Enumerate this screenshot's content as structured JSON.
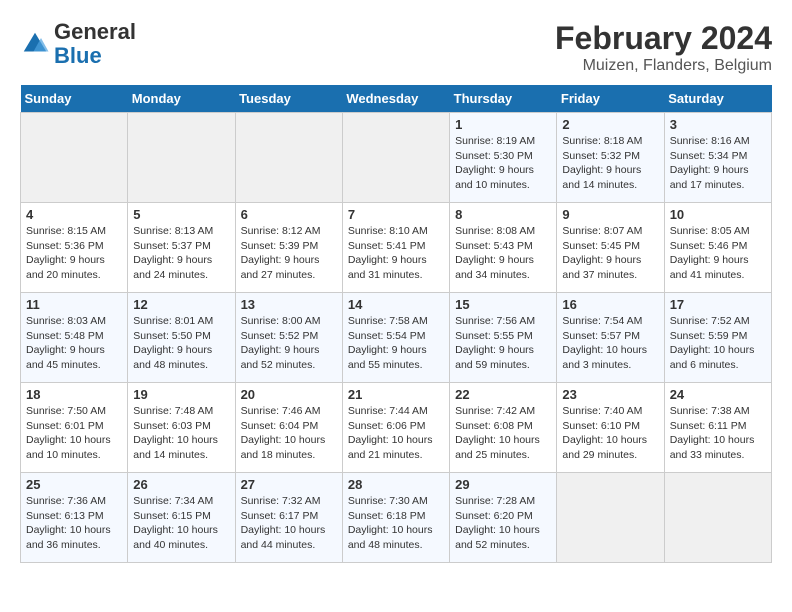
{
  "logo": {
    "text_general": "General",
    "text_blue": "Blue"
  },
  "title": "February 2024",
  "subtitle": "Muizen, Flanders, Belgium",
  "days_of_week": [
    "Sunday",
    "Monday",
    "Tuesday",
    "Wednesday",
    "Thursday",
    "Friday",
    "Saturday"
  ],
  "weeks": [
    [
      {
        "day": "",
        "info": ""
      },
      {
        "day": "",
        "info": ""
      },
      {
        "day": "",
        "info": ""
      },
      {
        "day": "",
        "info": ""
      },
      {
        "day": "1",
        "info": "Sunrise: 8:19 AM\nSunset: 5:30 PM\nDaylight: 9 hours and 10 minutes."
      },
      {
        "day": "2",
        "info": "Sunrise: 8:18 AM\nSunset: 5:32 PM\nDaylight: 9 hours and 14 minutes."
      },
      {
        "day": "3",
        "info": "Sunrise: 8:16 AM\nSunset: 5:34 PM\nDaylight: 9 hours and 17 minutes."
      }
    ],
    [
      {
        "day": "4",
        "info": "Sunrise: 8:15 AM\nSunset: 5:36 PM\nDaylight: 9 hours and 20 minutes."
      },
      {
        "day": "5",
        "info": "Sunrise: 8:13 AM\nSunset: 5:37 PM\nDaylight: 9 hours and 24 minutes."
      },
      {
        "day": "6",
        "info": "Sunrise: 8:12 AM\nSunset: 5:39 PM\nDaylight: 9 hours and 27 minutes."
      },
      {
        "day": "7",
        "info": "Sunrise: 8:10 AM\nSunset: 5:41 PM\nDaylight: 9 hours and 31 minutes."
      },
      {
        "day": "8",
        "info": "Sunrise: 8:08 AM\nSunset: 5:43 PM\nDaylight: 9 hours and 34 minutes."
      },
      {
        "day": "9",
        "info": "Sunrise: 8:07 AM\nSunset: 5:45 PM\nDaylight: 9 hours and 37 minutes."
      },
      {
        "day": "10",
        "info": "Sunrise: 8:05 AM\nSunset: 5:46 PM\nDaylight: 9 hours and 41 minutes."
      }
    ],
    [
      {
        "day": "11",
        "info": "Sunrise: 8:03 AM\nSunset: 5:48 PM\nDaylight: 9 hours and 45 minutes."
      },
      {
        "day": "12",
        "info": "Sunrise: 8:01 AM\nSunset: 5:50 PM\nDaylight: 9 hours and 48 minutes."
      },
      {
        "day": "13",
        "info": "Sunrise: 8:00 AM\nSunset: 5:52 PM\nDaylight: 9 hours and 52 minutes."
      },
      {
        "day": "14",
        "info": "Sunrise: 7:58 AM\nSunset: 5:54 PM\nDaylight: 9 hours and 55 minutes."
      },
      {
        "day": "15",
        "info": "Sunrise: 7:56 AM\nSunset: 5:55 PM\nDaylight: 9 hours and 59 minutes."
      },
      {
        "day": "16",
        "info": "Sunrise: 7:54 AM\nSunset: 5:57 PM\nDaylight: 10 hours and 3 minutes."
      },
      {
        "day": "17",
        "info": "Sunrise: 7:52 AM\nSunset: 5:59 PM\nDaylight: 10 hours and 6 minutes."
      }
    ],
    [
      {
        "day": "18",
        "info": "Sunrise: 7:50 AM\nSunset: 6:01 PM\nDaylight: 10 hours and 10 minutes."
      },
      {
        "day": "19",
        "info": "Sunrise: 7:48 AM\nSunset: 6:03 PM\nDaylight: 10 hours and 14 minutes."
      },
      {
        "day": "20",
        "info": "Sunrise: 7:46 AM\nSunset: 6:04 PM\nDaylight: 10 hours and 18 minutes."
      },
      {
        "day": "21",
        "info": "Sunrise: 7:44 AM\nSunset: 6:06 PM\nDaylight: 10 hours and 21 minutes."
      },
      {
        "day": "22",
        "info": "Sunrise: 7:42 AM\nSunset: 6:08 PM\nDaylight: 10 hours and 25 minutes."
      },
      {
        "day": "23",
        "info": "Sunrise: 7:40 AM\nSunset: 6:10 PM\nDaylight: 10 hours and 29 minutes."
      },
      {
        "day": "24",
        "info": "Sunrise: 7:38 AM\nSunset: 6:11 PM\nDaylight: 10 hours and 33 minutes."
      }
    ],
    [
      {
        "day": "25",
        "info": "Sunrise: 7:36 AM\nSunset: 6:13 PM\nDaylight: 10 hours and 36 minutes."
      },
      {
        "day": "26",
        "info": "Sunrise: 7:34 AM\nSunset: 6:15 PM\nDaylight: 10 hours and 40 minutes."
      },
      {
        "day": "27",
        "info": "Sunrise: 7:32 AM\nSunset: 6:17 PM\nDaylight: 10 hours and 44 minutes."
      },
      {
        "day": "28",
        "info": "Sunrise: 7:30 AM\nSunset: 6:18 PM\nDaylight: 10 hours and 48 minutes."
      },
      {
        "day": "29",
        "info": "Sunrise: 7:28 AM\nSunset: 6:20 PM\nDaylight: 10 hours and 52 minutes."
      },
      {
        "day": "",
        "info": ""
      },
      {
        "day": "",
        "info": ""
      }
    ]
  ]
}
